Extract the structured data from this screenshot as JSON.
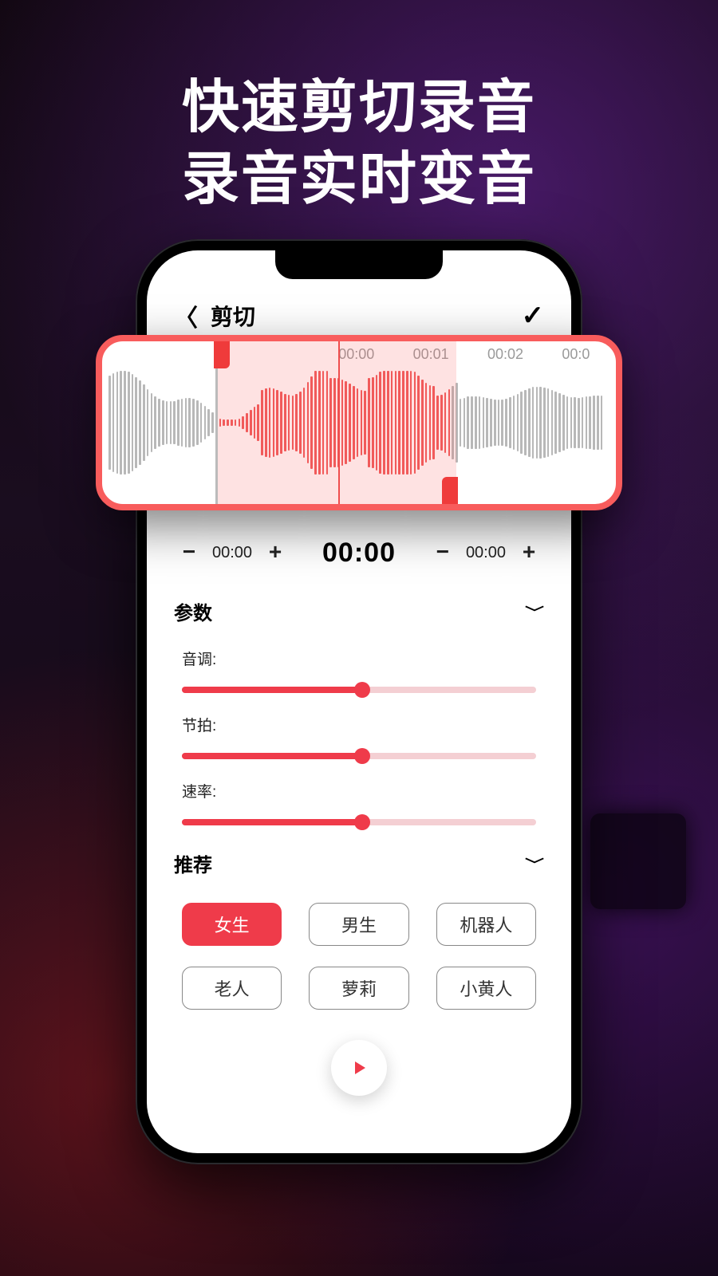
{
  "headline": {
    "line1": "快速剪切录音",
    "line2": "录音实时变音"
  },
  "nav": {
    "title": "剪切"
  },
  "timeline": {
    "ticks": [
      "00:00",
      "00:01",
      "00:02",
      "00:0"
    ],
    "selection_start_pct": 22,
    "selection_end_pct": 69
  },
  "steppers": {
    "left_value": "00:00",
    "center_value": "00:00",
    "right_value": "00:00"
  },
  "sections": {
    "params": "参数",
    "presets": "推荐"
  },
  "params": {
    "pitch": {
      "label": "音调:",
      "value_pct": 51
    },
    "tempo": {
      "label": "节拍:",
      "value_pct": 51
    },
    "rate": {
      "label": "速率:",
      "value_pct": 51
    }
  },
  "presets": [
    {
      "label": "女生",
      "active": true
    },
    {
      "label": "男生",
      "active": false
    },
    {
      "label": "机器人",
      "active": false
    },
    {
      "label": "老人",
      "active": false
    },
    {
      "label": "萝莉",
      "active": false
    },
    {
      "label": "小黄人",
      "active": false
    }
  ],
  "colors": {
    "accent": "#ef3b4a"
  }
}
